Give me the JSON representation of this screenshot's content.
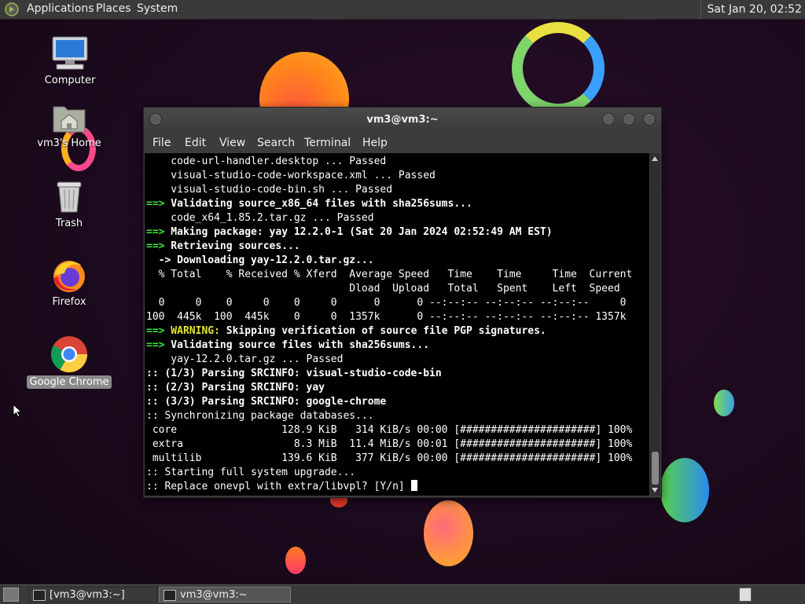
{
  "top_panel": {
    "menus": [
      "Applications",
      "Places",
      "System"
    ],
    "clock": "Sat Jan 20, 02:52"
  },
  "desktop": {
    "icons": [
      {
        "label": "Computer",
        "icon": "computer-icon"
      },
      {
        "label": "vm3's Home",
        "icon": "home-folder-icon"
      },
      {
        "label": "Trash",
        "icon": "trash-icon"
      },
      {
        "label": "Firefox",
        "icon": "firefox-icon"
      },
      {
        "label": "Google Chrome",
        "icon": "chrome-icon",
        "selected": true
      }
    ]
  },
  "terminal": {
    "title": "vm3@vm3:~",
    "menu": [
      "File",
      "Edit",
      "View",
      "Search",
      "Terminal",
      "Help"
    ],
    "lines": [
      {
        "text": "    code-url-handler.desktop ... Passed"
      },
      {
        "text": "    visual-studio-code-workspace.xml ... Passed"
      },
      {
        "text": "    visual-studio-code-bin.sh ... Passed"
      },
      {
        "prefix": "==>",
        "text": " Validating source_x86_64 files with sha256sums...",
        "style": "bold"
      },
      {
        "text": "    code_x64_1.85.2.tar.gz ... Passed"
      },
      {
        "prefix": "==>",
        "text": " Making package: yay 12.2.0-1 (Sat 20 Jan 2024 02:52:49 AM EST)",
        "style": "bold"
      },
      {
        "prefix": "==>",
        "text": " Retrieving sources...",
        "style": "bold"
      },
      {
        "text": "  -> Downloading yay-12.2.0.tar.gz...",
        "style": "bold"
      },
      {
        "text": "  % Total    % Received % Xferd  Average Speed   Time    Time     Time  Current"
      },
      {
        "text": "                                 Dload  Upload   Total   Spent    Left  Speed"
      },
      {
        "text": "  0     0    0     0    0     0      0      0 --:--:-- --:--:-- --:--:--     0"
      },
      {
        "text": "100  445k  100  445k    0     0  1357k      0 --:--:-- --:--:-- --:--:-- 1357k"
      },
      {
        "prefix": "==>",
        "warn": " WARNING:",
        "text": " Skipping verification of source file PGP signatures.",
        "style": "bold"
      },
      {
        "prefix": "==>",
        "text": " Validating source files with sha256sums...",
        "style": "bold"
      },
      {
        "text": "    yay-12.2.0.tar.gz ... Passed"
      },
      {
        "text": ":: (1/3) Parsing SRCINFO: visual-studio-code-bin",
        "style": "bold"
      },
      {
        "text": ":: (2/3) Parsing SRCINFO: yay",
        "style": "bold"
      },
      {
        "text": ":: (3/3) Parsing SRCINFO: google-chrome",
        "style": "bold"
      },
      {
        "text": ":: Synchronizing package databases..."
      },
      {
        "text": " core                 128.9 KiB   314 KiB/s 00:00 [######################] 100%"
      },
      {
        "text": " extra                  8.3 MiB  11.4 MiB/s 00:01 [######################] 100%"
      },
      {
        "text": " multilib             139.6 KiB   377 KiB/s 00:00 [######################] 100%"
      },
      {
        "text": ":: Starting full system upgrade..."
      },
      {
        "text": ":: Replace onevpl with extra/libvpl? [Y/n] ",
        "cursor": true
      }
    ]
  },
  "taskbar": {
    "tasks": [
      {
        "label": "[vm3@vm3:~]",
        "active": false
      },
      {
        "label": "vm3@vm3:~",
        "active": true
      }
    ]
  },
  "colors": {
    "panel": "#3a3a3a",
    "terminal_bg": "#000000",
    "prompt_green": "#3ee83e",
    "warning_yellow": "#e6e62e"
  }
}
